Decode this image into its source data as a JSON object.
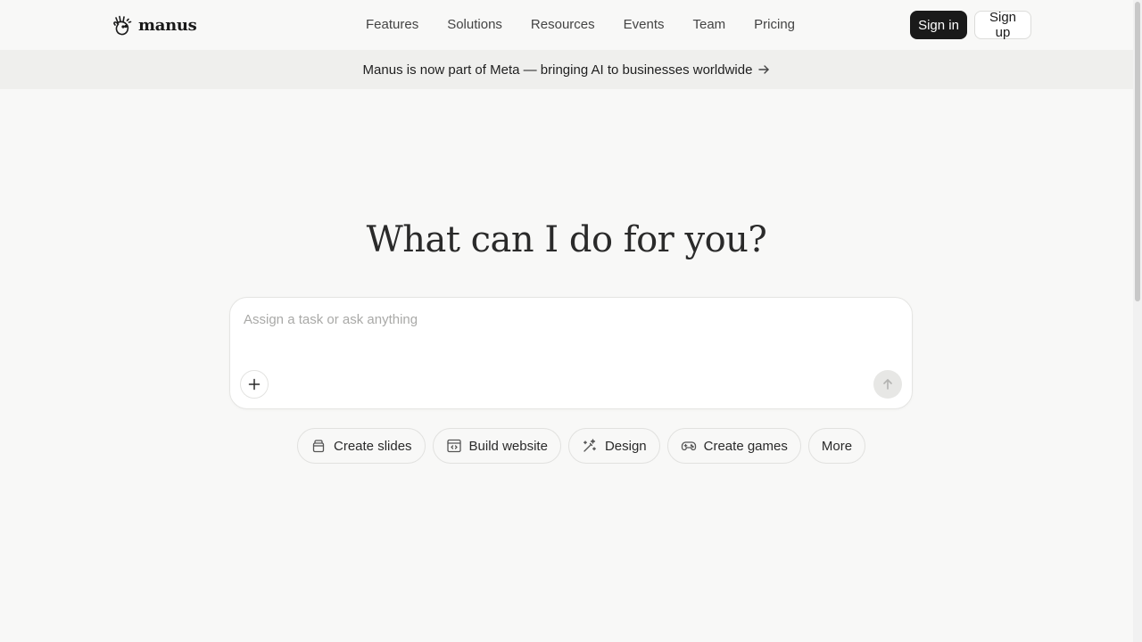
{
  "header": {
    "brand": "manus",
    "nav": [
      "Features",
      "Solutions",
      "Resources",
      "Events",
      "Team",
      "Pricing"
    ],
    "sign_in": "Sign in",
    "sign_up": "Sign up"
  },
  "banner": {
    "text": "Manus is now part of Meta — bringing AI to businesses worldwide"
  },
  "hero": {
    "title": "What can I do for you?"
  },
  "composer": {
    "placeholder": "Assign a task or ask anything"
  },
  "chips": [
    {
      "label": "Create slides",
      "icon": "slides-icon"
    },
    {
      "label": "Build website",
      "icon": "website-icon"
    },
    {
      "label": "Design",
      "icon": "design-icon"
    },
    {
      "label": "Create games",
      "icon": "gamepad-icon"
    },
    {
      "label": "More",
      "icon": ""
    }
  ],
  "colors": {
    "background": "#f8f8f7",
    "banner": "#efefed",
    "primary_button": "#1a1a1a",
    "send_button": "#e7e7e5"
  }
}
